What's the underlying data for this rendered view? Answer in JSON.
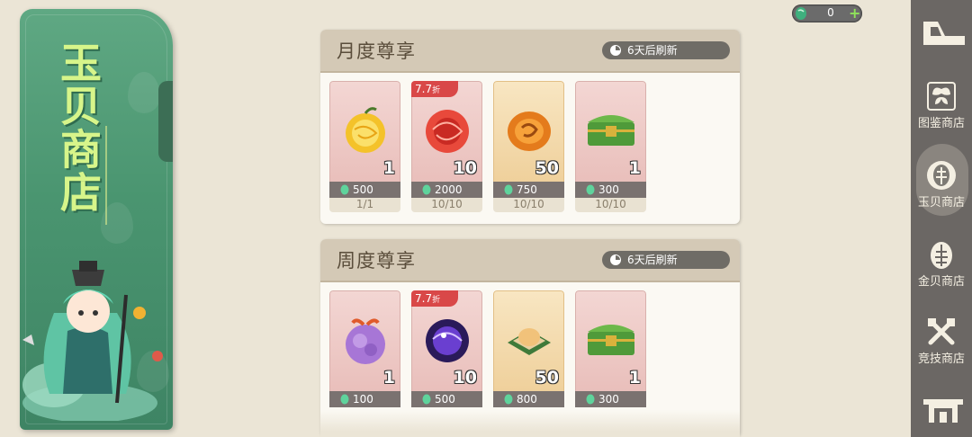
{
  "banner": {
    "title": "玉贝商店"
  },
  "currency": {
    "value": "0",
    "plus": "+"
  },
  "sidebar": {
    "items": [
      {
        "label": "图鉴商店",
        "icon": "butterfly-icon",
        "active": false
      },
      {
        "label": "玉贝商店",
        "icon": "leaf-shell-icon",
        "active": true
      },
      {
        "label": "金贝商店",
        "icon": "gold-shell-icon",
        "active": false
      },
      {
        "label": "竞技商店",
        "icon": "crossed-swords-icon",
        "active": false
      }
    ]
  },
  "sections": [
    {
      "title": "月度尊享",
      "refresh": "6天后刷新",
      "cards": [
        {
          "item": "golden-fruit",
          "qty": "1",
          "price": "500",
          "limit": "1/1",
          "discount": "",
          "bg": "pink"
        },
        {
          "item": "red-orb",
          "qty": "10",
          "price": "2000",
          "limit": "10/10",
          "discount": "7.7",
          "bg": "pink"
        },
        {
          "item": "amber-stone",
          "qty": "50",
          "price": "750",
          "limit": "10/10",
          "discount": "",
          "bg": "gold"
        },
        {
          "item": "jade-chest",
          "qty": "1",
          "price": "300",
          "limit": "10/10",
          "discount": "",
          "bg": "pink"
        }
      ]
    },
    {
      "title": "周度尊享",
      "refresh": "6天后刷新",
      "cards": [
        {
          "item": "purple-fruit",
          "qty": "1",
          "price": "100",
          "limit": "",
          "discount": "",
          "bg": "pink"
        },
        {
          "item": "purple-orb",
          "qty": "10",
          "price": "500",
          "limit": "",
          "discount": "7.7",
          "bg": "pink"
        },
        {
          "item": "gold-nugget-box",
          "qty": "50",
          "price": "800",
          "limit": "",
          "discount": "",
          "bg": "gold"
        },
        {
          "item": "jade-chest",
          "qty": "1",
          "price": "300",
          "limit": "",
          "discount": "",
          "bg": "pink"
        }
      ]
    }
  ],
  "discount_suffix": "折",
  "colors": {
    "banner_green": "#4a9570",
    "title_green": "#d7f58a",
    "discount_red": "#d94848",
    "sidebar": "#6b6764"
  }
}
